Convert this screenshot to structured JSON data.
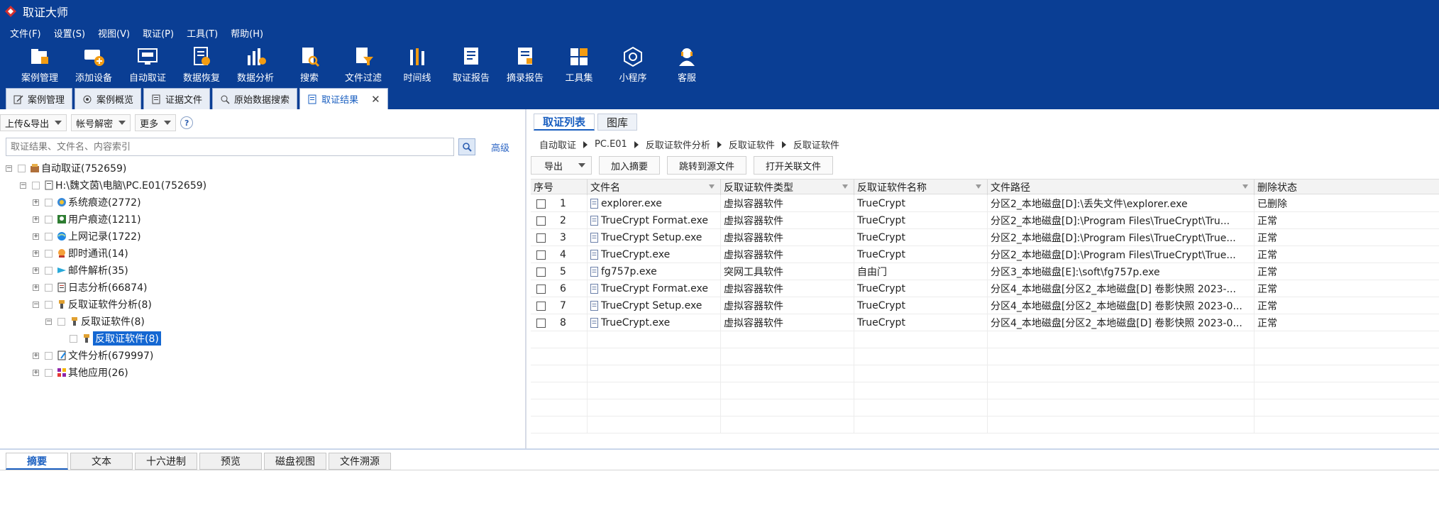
{
  "app": {
    "title": "取证大师"
  },
  "menu": [
    "文件(F)",
    "设置(S)",
    "视图(V)",
    "取证(P)",
    "工具(T)",
    "帮助(H)"
  ],
  "ribbon": [
    {
      "label": "案例管理",
      "icon": "case-folder-icon"
    },
    {
      "label": "添加设备",
      "icon": "add-device-icon"
    },
    {
      "label": "自动取证",
      "icon": "auto-forensics-icon"
    },
    {
      "label": "数据恢复",
      "icon": "data-recovery-icon"
    },
    {
      "label": "数据分析",
      "icon": "data-analysis-icon"
    },
    {
      "label": "搜索",
      "icon": "search-doc-icon"
    },
    {
      "label": "文件过滤",
      "icon": "file-filter-icon"
    },
    {
      "label": "时间线",
      "icon": "timeline-icon"
    },
    {
      "label": "取证报告",
      "icon": "report-icon"
    },
    {
      "label": "摘录报告",
      "icon": "excerpt-report-icon"
    },
    {
      "label": "工具集",
      "icon": "toolkit-icon"
    },
    {
      "label": "小程序",
      "icon": "mini-program-icon"
    },
    {
      "label": "客服",
      "icon": "customer-service-icon"
    }
  ],
  "doc_tabs": [
    {
      "label": "案例管理",
      "active": false
    },
    {
      "label": "案例概览",
      "active": false
    },
    {
      "label": "证据文件",
      "active": false
    },
    {
      "label": "原始数据搜索",
      "active": false
    },
    {
      "label": "取证结果",
      "active": true
    }
  ],
  "left": {
    "toolbar": {
      "upload_export": "上传&导出",
      "account_decrypt": "帐号解密",
      "more": "更多",
      "help": "?"
    },
    "search_placeholder": "取证结果、文件名、内容索引",
    "advanced": "高级",
    "tree": [
      {
        "label": "自动取证(752659)",
        "level": 0,
        "icon": "auto-forensics-icon"
      },
      {
        "label": "H:\\魏文茵\\电脑\\PC.E01(752659)",
        "level": 1,
        "icon": "evidence-file-icon"
      },
      {
        "label": "系统痕迹(2772)",
        "level": 2,
        "icon": "system-trace-icon"
      },
      {
        "label": "用户痕迹(1211)",
        "level": 2,
        "icon": "user-trace-icon"
      },
      {
        "label": "上网记录(1722)",
        "level": 2,
        "icon": "internet-icon"
      },
      {
        "label": "即时通讯(14)",
        "level": 2,
        "icon": "chat-icon"
      },
      {
        "label": "邮件解析(35)",
        "level": 2,
        "icon": "mail-icon"
      },
      {
        "label": "日志分析(66874)",
        "level": 2,
        "icon": "log-icon"
      },
      {
        "label": "反取证软件分析(8)",
        "level": 2,
        "icon": "anti-forensics-icon"
      },
      {
        "label": "反取证软件(8)",
        "level": 3,
        "icon": "anti-forensics-icon"
      },
      {
        "label": "反取证软件(8)",
        "level": 4,
        "icon": "anti-forensics-icon"
      },
      {
        "label": "文件分析(679997)",
        "level": 2,
        "icon": "file-analysis-icon"
      },
      {
        "label": "其他应用(26)",
        "level": 2,
        "icon": "other-apps-icon"
      }
    ]
  },
  "right": {
    "tabs": [
      {
        "label": "取证列表",
        "active": true
      },
      {
        "label": "图库",
        "active": false
      }
    ],
    "breadcrumb": [
      "自动取证",
      "PC.E01",
      "反取证软件分析",
      "反取证软件",
      "反取证软件"
    ],
    "actions": {
      "export": "导出",
      "add_summary": "加入摘要",
      "jump_source": "跳转到源文件",
      "open_related": "打开关联文件"
    },
    "columns": [
      "序号",
      "文件名",
      "反取证软件类型",
      "反取证软件名称",
      "文件路径",
      "删除状态"
    ],
    "rows": [
      {
        "no": "1",
        "name": "explorer.exe",
        "type": "虚拟容器软件",
        "soft": "TrueCrypt",
        "path": "分区2_本地磁盘[D]:\\丢失文件\\explorer.exe",
        "status": "已删除"
      },
      {
        "no": "2",
        "name": "TrueCrypt Format.exe",
        "type": "虚拟容器软件",
        "soft": "TrueCrypt",
        "path": "分区2_本地磁盘[D]:\\Program Files\\TrueCrypt\\Tru...",
        "status": "正常"
      },
      {
        "no": "3",
        "name": "TrueCrypt Setup.exe",
        "type": "虚拟容器软件",
        "soft": "TrueCrypt",
        "path": "分区2_本地磁盘[D]:\\Program Files\\TrueCrypt\\True...",
        "status": "正常"
      },
      {
        "no": "4",
        "name": "TrueCrypt.exe",
        "type": "虚拟容器软件",
        "soft": "TrueCrypt",
        "path": "分区2_本地磁盘[D]:\\Program Files\\TrueCrypt\\True...",
        "status": "正常"
      },
      {
        "no": "5",
        "name": "fg757p.exe",
        "type": "突网工具软件",
        "soft": "自由门",
        "path": "分区3_本地磁盘[E]:\\soft\\fg757p.exe",
        "status": "正常"
      },
      {
        "no": "6",
        "name": "TrueCrypt Format.exe",
        "type": "虚拟容器软件",
        "soft": "TrueCrypt",
        "path": "分区4_本地磁盘[分区2_本地磁盘[D] 卷影快照 2023-...",
        "status": "正常"
      },
      {
        "no": "7",
        "name": "TrueCrypt Setup.exe",
        "type": "虚拟容器软件",
        "soft": "TrueCrypt",
        "path": "分区4_本地磁盘[分区2_本地磁盘[D] 卷影快照 2023-0...",
        "status": "正常"
      },
      {
        "no": "8",
        "name": "TrueCrypt.exe",
        "type": "虚拟容器软件",
        "soft": "TrueCrypt",
        "path": "分区4_本地磁盘[分区2_本地磁盘[D] 卷影快照 2023-0...",
        "status": "正常"
      }
    ]
  },
  "bottom_tabs": [
    {
      "label": "摘要",
      "active": true
    },
    {
      "label": "文本",
      "active": false
    },
    {
      "label": "十六进制",
      "active": false
    },
    {
      "label": "预览",
      "active": false
    },
    {
      "label": "磁盘视图",
      "active": false
    },
    {
      "label": "文件溯源",
      "active": false
    }
  ],
  "colors": {
    "brand": "#0a3e94",
    "accent": "#1467d2",
    "link": "#2d66c4"
  }
}
